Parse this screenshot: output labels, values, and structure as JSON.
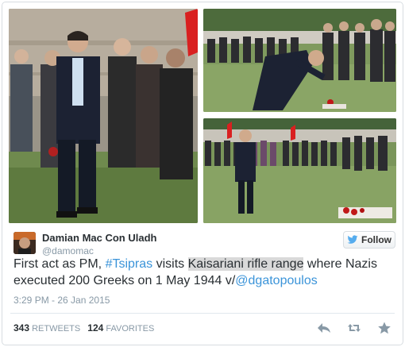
{
  "author": {
    "name": "Damian Mac Con Uladh",
    "handle": "@damomac"
  },
  "follow_label": "Follow",
  "tweet": {
    "part1": "First act as PM, ",
    "hashtag": "#Tsipras",
    "part2": " visits ",
    "highlight": "Kaisariani rifle range",
    "part3": " where Nazis executed 200 Greeks on 1 May 1944 v/",
    "mention": "@dgatopoulos"
  },
  "timestamp": "3:29 PM - 26 Jan 2015",
  "stats": {
    "retweets_count": "343",
    "retweets_label": "RETWEETS",
    "favorites_count": "124",
    "favorites_label": "FAVORITES"
  },
  "colors": {
    "link": "#3b94d9",
    "muted": "#8899a6",
    "text": "#292f33"
  }
}
